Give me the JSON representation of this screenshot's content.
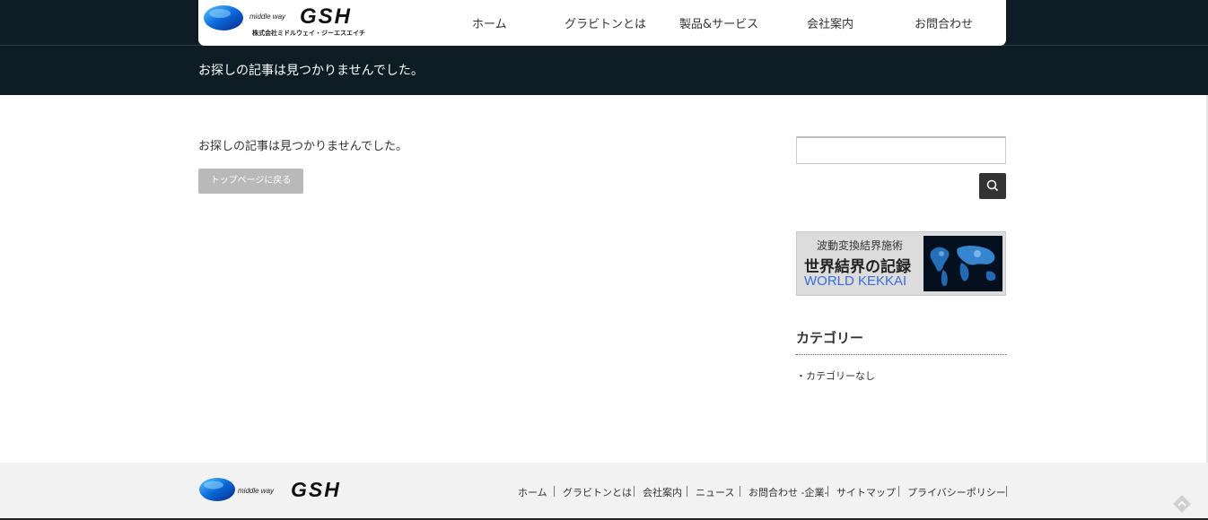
{
  "brand": {
    "logo_small": "middle way",
    "logo_big": "GSH",
    "logo_sub": "株式会社ミドルウェイ・ジーエスエイチ"
  },
  "nav": {
    "items": [
      "ホーム",
      "グラビトンとは",
      "製品&サービス",
      "会社案内",
      "お問合わせ"
    ]
  },
  "page": {
    "title": "お探しの記事は見つかりませんでした。",
    "message": "お探しの記事は見つかりませんでした。",
    "back_button": "トップページに戻る"
  },
  "sidebar": {
    "search_placeholder": "",
    "banner": {
      "line1": "波動変換結界施術",
      "line2": "世界結界の記録",
      "line3": "WORLD KEKKAI"
    },
    "category_title": "カテゴリー",
    "category_items": [
      "カテゴリーなし"
    ]
  },
  "footer": {
    "logo_small": "middle way",
    "logo_big": "GSH",
    "links": [
      "ホーム",
      "グラビトンとは",
      "会社案内",
      "ニュース",
      "お問合わせ -企業-",
      "サイトマップ",
      "プライバシーポリシー"
    ]
  },
  "colors": {
    "header_bg": "#0e1c26",
    "button_gray": "#b9b9b9",
    "search_button": "#333333",
    "footer_bg": "#f2f2f2",
    "banner_accent": "#3b6fd8"
  }
}
